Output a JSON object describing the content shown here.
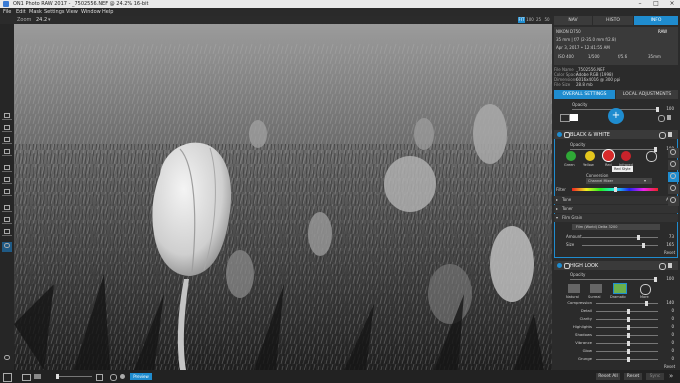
{
  "window": {
    "title": "ON1 Photo RAW 2017 - _7502556.NEF @ 24.2% 16-bit"
  },
  "menu": [
    "File",
    "Edit",
    "Mask",
    "Settings",
    "View",
    "Window",
    "Help"
  ],
  "toolbar": {
    "zoom_label": "Zoom",
    "zoom_value": "24.2",
    "zoom_buttons": [
      "FIT",
      "100",
      "25",
      "50"
    ]
  },
  "panel_tabs": [
    {
      "label": "NAV",
      "active": false
    },
    {
      "label": "HISTO",
      "active": false
    },
    {
      "label": "INFO",
      "active": true
    }
  ],
  "info": {
    "camera": "NIKON D750",
    "raw_badge": "RAW",
    "lens": "35 mm | f/7 (2-35.0 mm f/2.8)",
    "date": "Apr 3, 2017 • 12:41:55 AM",
    "exif": [
      "ISO 400",
      "1/500",
      "f/5.6",
      "35mm"
    ],
    "file_name_label": "File Name",
    "file_name": "_7502556.NEF",
    "color_space_label": "Color Space",
    "color_space": "Adobe RGB (1998)",
    "dimensions_label": "Dimensions",
    "dimensions": "6016x4016 @ 300 ppi",
    "file_size_label": "File Size",
    "file_size": "28.8 mb"
  },
  "settings_tabs": [
    {
      "label": "OVERALL SETTINGS",
      "active": true
    },
    {
      "label": "LOCAL ADJUSTMENTS",
      "active": false
    }
  ],
  "overall": {
    "opacity_label": "Opacity",
    "opacity_value": "100"
  },
  "bw": {
    "title": "BLACK & WHITE",
    "opacity_label": "Opacity",
    "opacity_value": "100",
    "filters": [
      {
        "label": "Green",
        "color": "#2fa836"
      },
      {
        "label": "Yellow",
        "color": "#e4c61d"
      },
      {
        "label": "Red",
        "color": "#d82a2a"
      },
      {
        "label": "Infrared",
        "color": "#c8232b"
      }
    ],
    "tooltip": "Red Style",
    "conversion_label": "Conversion",
    "conversion_value": "Channel Mixer",
    "filter_label": "Filter",
    "tone_label": "Tone",
    "tone_auto": "Auto",
    "toner_label": "Toner",
    "film_grain_label": "Film Grain",
    "film_value": "Film (World) Delta 3200",
    "amount_label": "Amount",
    "amount_value": "73",
    "size_label": "Size",
    "size_value": "165",
    "reset_label": "Reset"
  },
  "look": {
    "title": "HIGH LOOK",
    "opacity_label": "Opacity",
    "opacity_value": "100",
    "presets": [
      "Natural",
      "Surreal",
      "Dramatic",
      "More"
    ],
    "sliders": [
      {
        "label": "Compression",
        "value": "140"
      },
      {
        "label": "Detail",
        "value": "0"
      },
      {
        "label": "Clarity",
        "value": "0"
      },
      {
        "label": "Highlights",
        "value": "0"
      },
      {
        "label": "Shadows",
        "value": "0"
      },
      {
        "label": "Vibrance",
        "value": "0"
      },
      {
        "label": "Glow",
        "value": "0"
      },
      {
        "label": "Grunge",
        "value": "0"
      }
    ],
    "reset_label": "Reset"
  },
  "bottom": {
    "preview_label": "Preview",
    "reset_all_label": "Reset All",
    "reset_label": "Reset",
    "sync_label": "Sync"
  },
  "colors": {
    "accent": "#1f8ccf",
    "panel": "#2b2b2b",
    "section": "#3a3a3a"
  }
}
